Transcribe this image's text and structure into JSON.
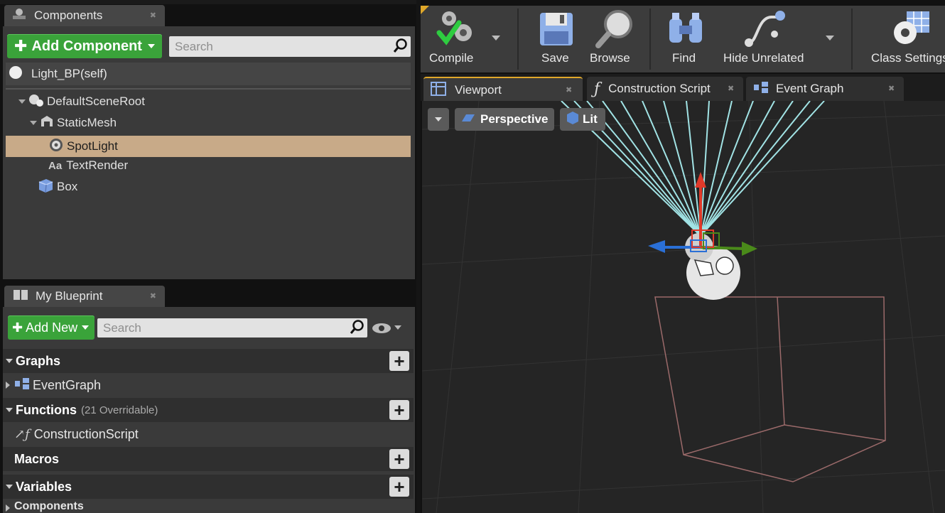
{
  "components_panel": {
    "tab_title": "Components",
    "add_button": "Add Component",
    "search_placeholder": "Search",
    "self_item": "Light_BP(self)",
    "tree": [
      {
        "label": "DefaultSceneRoot",
        "selected": false
      },
      {
        "label": "StaticMesh",
        "selected": false
      },
      {
        "label": "SpotLight",
        "selected": true
      },
      {
        "label": "TextRender",
        "selected": false
      },
      {
        "label": "Box",
        "selected": false
      }
    ]
  },
  "my_blueprint": {
    "tab_title": "My Blueprint",
    "add_button": "Add New",
    "search_placeholder": "Search",
    "sections": {
      "graphs": "Graphs",
      "event_graph": "EventGraph",
      "functions": "Functions",
      "functions_note": "(21 Overridable)",
      "construction_script": "ConstructionScript",
      "macros": "Macros",
      "variables": "Variables",
      "components": "Components"
    }
  },
  "toolbar": {
    "compile": "Compile",
    "save": "Save",
    "browse": "Browse",
    "find": "Find",
    "hide_unrelated": "Hide Unrelated",
    "class_settings": "Class Settings"
  },
  "editor_tabs": {
    "viewport": "Viewport",
    "construction_script": "Construction Script",
    "event_graph": "Event Graph"
  },
  "viewport": {
    "perspective": "Perspective",
    "lit": "Lit"
  },
  "colors": {
    "selected_row": "#c8aa88",
    "add_button": "#3aa33a",
    "active_tab_accent": "#e0a82a"
  }
}
